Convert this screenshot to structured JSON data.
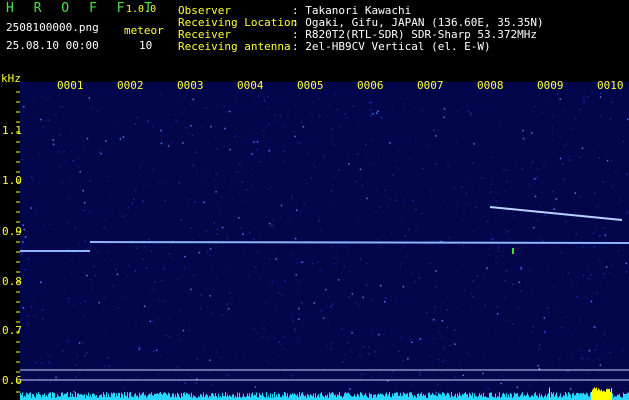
{
  "app": {
    "title": "H R O F F T",
    "version": "1.0.0",
    "filename": "2508100000.png",
    "datetime": "25.08.10 00:00",
    "meteor_label": "meteor",
    "meteor_count": "10"
  },
  "info": {
    "observer_label": "Observer",
    "observer_value": ": Takanori Kawachi",
    "location_label": "Receiving Location",
    "location_value": ": Ogaki, Gifu, JAPAN (136.60E, 35.35N)",
    "receiver_label": "Receiver",
    "receiver_value": ": R820T2(RTL-SDR) SDR-Sharp 53.372MHz",
    "antenna_label": "Receiving antenna",
    "antenna_value": ": 2el-HB9CV Vertical (el. E-W)"
  },
  "axis": {
    "unit": "kHz",
    "y_ticks": [
      "1.1",
      "1.0",
      "0.9",
      "0.8",
      "0.7",
      "0.6"
    ],
    "x_ticks": [
      "0001",
      "0002",
      "0003",
      "0004",
      "0005",
      "0006",
      "0007",
      "0008",
      "0009",
      "0010"
    ]
  },
  "colors": {
    "background": "#000000",
    "spectrogram_bg": "#03064a",
    "signal": "#a8c8ff",
    "text_green": "#4be04b",
    "text_white": "#ffffff",
    "text_yellow": "#ffff33",
    "power_bar": "#27d7ff",
    "power_peak": "#ffff00"
  }
}
